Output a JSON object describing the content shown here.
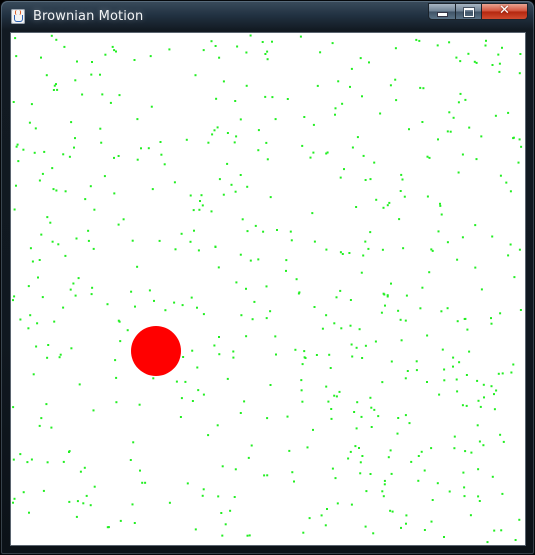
{
  "window": {
    "title": "Brownian Motion",
    "icon": "java-cup-icon",
    "controls": {
      "minimize": "minimize-icon",
      "maximize": "maximize-icon",
      "close": "close-icon"
    }
  },
  "canvas": {
    "background": "#ffffff",
    "particle_color": "#22ee22",
    "ball_color": "#ff0000",
    "particle_count": 600
  }
}
